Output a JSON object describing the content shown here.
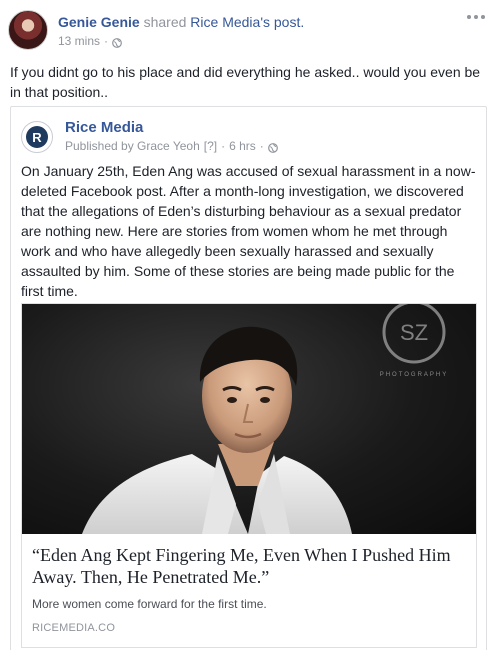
{
  "post": {
    "author_name": "Genie Genie",
    "shared_word": "shared",
    "page_name": "Rice Media",
    "possessive_suffix": "'s post.",
    "timestamp": "13 mins",
    "separator": "·",
    "privacy_icon": "globe-icon",
    "more_icon": "more-options-icon",
    "status_text": "If you didnt go to his place and did everything he asked.. would you even be in that position.."
  },
  "shared_post": {
    "page_name": "Rice Media",
    "logo_letter": "R",
    "published_by_label": "Published by Grace Yeoh",
    "help_marker": "[?]",
    "timestamp": "6 hrs",
    "separator": "·",
    "privacy_icon": "globe-icon",
    "body_text": "On January 25th, Eden Ang was accused of sexual harassment in a now-deleted Facebook post. After a month-long investigation, we discovered that the allegations of Eden’s disturbing behaviour as a sexual predator are nothing new. Here are stories from women whom he met through work and who have allegedly been sexually harassed and sexually assaulted by him. Some of these stories are being made public for the first time."
  },
  "link_preview": {
    "headline": "“Eden Ang Kept Fingering Me, Even When I Pushed Him Away. Then, He Penetrated Me.”",
    "description": "More women come forward for the first time.",
    "domain": "RICEMEDIA.CO",
    "watermark_text": "PHOTOGRAPHY"
  },
  "colors": {
    "link_blue": "#365899",
    "muted_gray": "#90949c",
    "text_dark": "#1d2129",
    "border": "#dddfe2"
  }
}
